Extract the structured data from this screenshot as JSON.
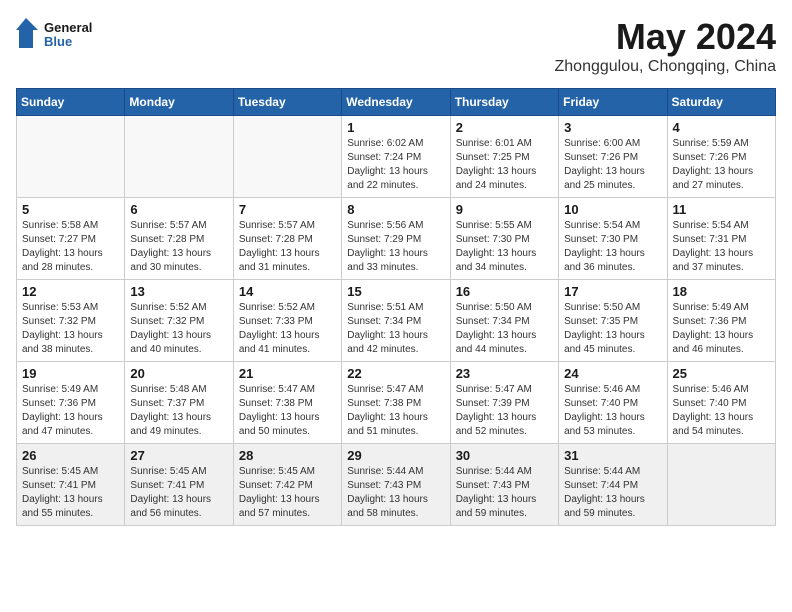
{
  "header": {
    "logo_line1": "General",
    "logo_line2": "Blue",
    "month_title": "May 2024",
    "location": "Zhonggulou, Chongqing, China"
  },
  "days_of_week": [
    "Sunday",
    "Monday",
    "Tuesday",
    "Wednesday",
    "Thursday",
    "Friday",
    "Saturday"
  ],
  "weeks": [
    [
      {
        "day": "",
        "info": ""
      },
      {
        "day": "",
        "info": ""
      },
      {
        "day": "",
        "info": ""
      },
      {
        "day": "1",
        "info": "Sunrise: 6:02 AM\nSunset: 7:24 PM\nDaylight: 13 hours and 22 minutes."
      },
      {
        "day": "2",
        "info": "Sunrise: 6:01 AM\nSunset: 7:25 PM\nDaylight: 13 hours and 24 minutes."
      },
      {
        "day": "3",
        "info": "Sunrise: 6:00 AM\nSunset: 7:26 PM\nDaylight: 13 hours and 25 minutes."
      },
      {
        "day": "4",
        "info": "Sunrise: 5:59 AM\nSunset: 7:26 PM\nDaylight: 13 hours and 27 minutes."
      }
    ],
    [
      {
        "day": "5",
        "info": "Sunrise: 5:58 AM\nSunset: 7:27 PM\nDaylight: 13 hours and 28 minutes."
      },
      {
        "day": "6",
        "info": "Sunrise: 5:57 AM\nSunset: 7:28 PM\nDaylight: 13 hours and 30 minutes."
      },
      {
        "day": "7",
        "info": "Sunrise: 5:57 AM\nSunset: 7:28 PM\nDaylight: 13 hours and 31 minutes."
      },
      {
        "day": "8",
        "info": "Sunrise: 5:56 AM\nSunset: 7:29 PM\nDaylight: 13 hours and 33 minutes."
      },
      {
        "day": "9",
        "info": "Sunrise: 5:55 AM\nSunset: 7:30 PM\nDaylight: 13 hours and 34 minutes."
      },
      {
        "day": "10",
        "info": "Sunrise: 5:54 AM\nSunset: 7:30 PM\nDaylight: 13 hours and 36 minutes."
      },
      {
        "day": "11",
        "info": "Sunrise: 5:54 AM\nSunset: 7:31 PM\nDaylight: 13 hours and 37 minutes."
      }
    ],
    [
      {
        "day": "12",
        "info": "Sunrise: 5:53 AM\nSunset: 7:32 PM\nDaylight: 13 hours and 38 minutes."
      },
      {
        "day": "13",
        "info": "Sunrise: 5:52 AM\nSunset: 7:32 PM\nDaylight: 13 hours and 40 minutes."
      },
      {
        "day": "14",
        "info": "Sunrise: 5:52 AM\nSunset: 7:33 PM\nDaylight: 13 hours and 41 minutes."
      },
      {
        "day": "15",
        "info": "Sunrise: 5:51 AM\nSunset: 7:34 PM\nDaylight: 13 hours and 42 minutes."
      },
      {
        "day": "16",
        "info": "Sunrise: 5:50 AM\nSunset: 7:34 PM\nDaylight: 13 hours and 44 minutes."
      },
      {
        "day": "17",
        "info": "Sunrise: 5:50 AM\nSunset: 7:35 PM\nDaylight: 13 hours and 45 minutes."
      },
      {
        "day": "18",
        "info": "Sunrise: 5:49 AM\nSunset: 7:36 PM\nDaylight: 13 hours and 46 minutes."
      }
    ],
    [
      {
        "day": "19",
        "info": "Sunrise: 5:49 AM\nSunset: 7:36 PM\nDaylight: 13 hours and 47 minutes."
      },
      {
        "day": "20",
        "info": "Sunrise: 5:48 AM\nSunset: 7:37 PM\nDaylight: 13 hours and 49 minutes."
      },
      {
        "day": "21",
        "info": "Sunrise: 5:47 AM\nSunset: 7:38 PM\nDaylight: 13 hours and 50 minutes."
      },
      {
        "day": "22",
        "info": "Sunrise: 5:47 AM\nSunset: 7:38 PM\nDaylight: 13 hours and 51 minutes."
      },
      {
        "day": "23",
        "info": "Sunrise: 5:47 AM\nSunset: 7:39 PM\nDaylight: 13 hours and 52 minutes."
      },
      {
        "day": "24",
        "info": "Sunrise: 5:46 AM\nSunset: 7:40 PM\nDaylight: 13 hours and 53 minutes."
      },
      {
        "day": "25",
        "info": "Sunrise: 5:46 AM\nSunset: 7:40 PM\nDaylight: 13 hours and 54 minutes."
      }
    ],
    [
      {
        "day": "26",
        "info": "Sunrise: 5:45 AM\nSunset: 7:41 PM\nDaylight: 13 hours and 55 minutes."
      },
      {
        "day": "27",
        "info": "Sunrise: 5:45 AM\nSunset: 7:41 PM\nDaylight: 13 hours and 56 minutes."
      },
      {
        "day": "28",
        "info": "Sunrise: 5:45 AM\nSunset: 7:42 PM\nDaylight: 13 hours and 57 minutes."
      },
      {
        "day": "29",
        "info": "Sunrise: 5:44 AM\nSunset: 7:43 PM\nDaylight: 13 hours and 58 minutes."
      },
      {
        "day": "30",
        "info": "Sunrise: 5:44 AM\nSunset: 7:43 PM\nDaylight: 13 hours and 59 minutes."
      },
      {
        "day": "31",
        "info": "Sunrise: 5:44 AM\nSunset: 7:44 PM\nDaylight: 13 hours and 59 minutes."
      },
      {
        "day": "",
        "info": ""
      }
    ]
  ]
}
